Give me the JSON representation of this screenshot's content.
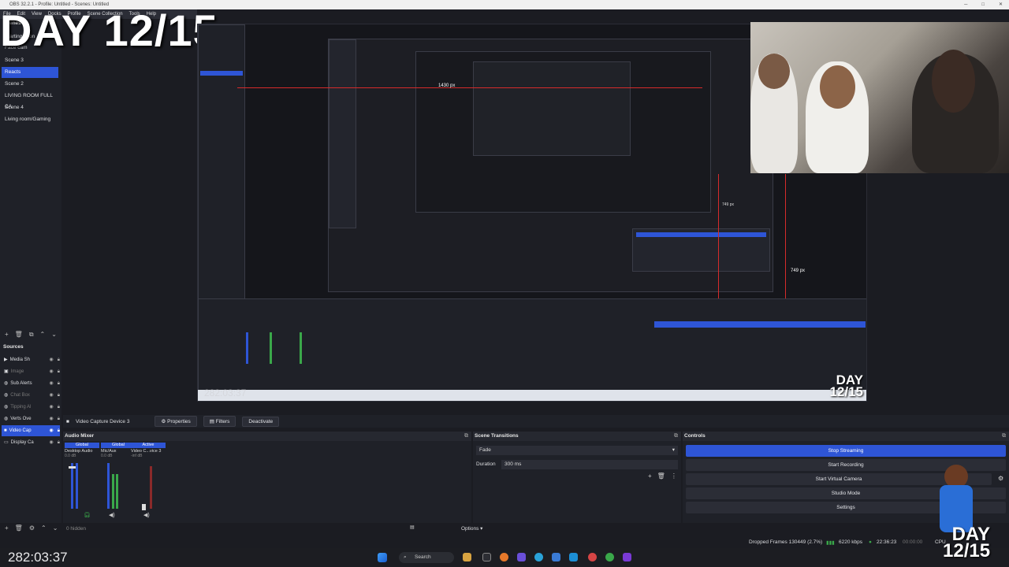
{
  "window": {
    "title": "OBS 32.2.1 - Profile: Untitled - Scenes: Untitled",
    "controls": [
      "─",
      "□",
      "✕"
    ]
  },
  "menu": {
    "items": [
      "File",
      "Edit",
      "View",
      "Docks",
      "Profile",
      "Scene Collection",
      "Tools",
      "Help"
    ]
  },
  "overlay": {
    "day_text": "DAY 12/15",
    "clock": "282:03:37",
    "day_corner_line1": "DAY",
    "day_corner_line2": "12/15"
  },
  "scenes": {
    "title": "Scenes",
    "items": [
      {
        "label": "Starting soon",
        "active": false
      },
      {
        "label": "Face cam",
        "active": false
      },
      {
        "label": "Scene 3",
        "active": false
      },
      {
        "label": "Reacts",
        "active": true
      },
      {
        "label": "Scene 2",
        "active": false
      },
      {
        "label": "LIVING ROOM FULL CA",
        "active": false
      },
      {
        "label": "Scene 4",
        "active": false
      },
      {
        "label": "Living room/Gaming",
        "active": false
      }
    ],
    "toolbar": [
      "+",
      "🗑",
      "⧉",
      "⌃",
      "⌄"
    ]
  },
  "sources": {
    "title": "Sources",
    "items": [
      {
        "label": "Media Sh",
        "active": false,
        "dim": false,
        "icon": "media-icon"
      },
      {
        "label": "Image",
        "active": false,
        "dim": true,
        "icon": "image-icon"
      },
      {
        "label": "Sub Alerts",
        "active": false,
        "dim": false,
        "icon": "browser-icon"
      },
      {
        "label": "Chat Box",
        "active": false,
        "dim": true,
        "icon": "browser-icon"
      },
      {
        "label": "Tipping Al",
        "active": false,
        "dim": true,
        "icon": "browser-icon"
      },
      {
        "label": "Verts Ove",
        "active": false,
        "dim": false,
        "icon": "browser-icon"
      },
      {
        "label": "Video Cap",
        "active": true,
        "dim": false,
        "icon": "camera-icon"
      },
      {
        "label": "Display Ca",
        "active": false,
        "dim": false,
        "icon": "display-icon"
      }
    ],
    "toolbar": [
      "+",
      "🗑",
      "⚙",
      "⌃",
      "⌄"
    ],
    "hidden_count": "0 hidden"
  },
  "preview": {
    "measure_1": "1430 px",
    "measure_2": "749 px",
    "measure_3": "749 px"
  },
  "properties_bar": {
    "source_name": "Video Capture Device 3",
    "properties_label": "Properties",
    "filters_label": "Filters",
    "deactivate_label": "Deactivate"
  },
  "audio_mixer": {
    "title": "Audio Mixer",
    "channels": [
      {
        "tag": "Global",
        "name": "Desktop Audio",
        "db": "0.0 dB"
      },
      {
        "tag": "Global",
        "name": "Mic/Aux",
        "db": "0.0 dB"
      },
      {
        "tag": "Active",
        "name": "Video C...vice 3",
        "db": "-inf dB"
      }
    ],
    "ticks": [
      "-5",
      "-10",
      "-15",
      "-20",
      "-25",
      "-30",
      "-35",
      "-40"
    ]
  },
  "scene_transitions": {
    "title": "Scene Transitions",
    "transition": "Fade",
    "duration_label": "Duration",
    "duration_value": "300 ms",
    "options_label": "Options"
  },
  "controls": {
    "title": "Controls",
    "buttons": [
      {
        "label": "Stop Streaming",
        "active": true
      },
      {
        "label": "Start Recording",
        "active": false
      },
      {
        "label": "Start Virtual Camera",
        "active": false
      },
      {
        "label": "Studio Mode",
        "active": false
      },
      {
        "label": "Settings",
        "active": false
      }
    ]
  },
  "statusbar": {
    "dropped_frames": "Dropped Frames 130449 (2.7%)",
    "bitrate": "6220 kbps",
    "stream_time": "22:36:23",
    "rec_time": "00:00:00",
    "cpu": "CPU"
  },
  "taskbar": {
    "search_placeholder": "Search"
  },
  "colors": {
    "accent": "#2e55d6",
    "bg": "#1b1c22",
    "dock": "#1f2128",
    "guide_red": "#d62b2b"
  }
}
